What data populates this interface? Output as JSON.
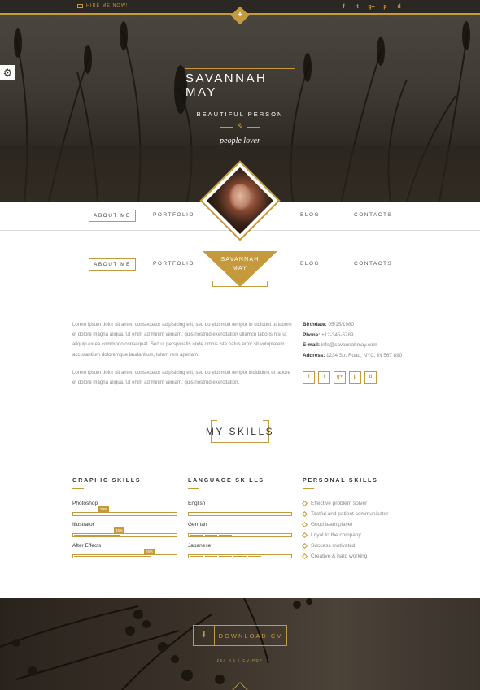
{
  "topbar": {
    "hire_label": "HIRE ME NOW!",
    "socials": [
      "f",
      "t",
      "g+",
      "p",
      "d"
    ],
    "accent": "#c49a3c",
    "background": "#2b2723"
  },
  "hero": {
    "name": "SAVANNAH MAY",
    "subtitle": "BEAUTIFUL PERSON",
    "ampersand": "&",
    "tagline": "people lover"
  },
  "nav": {
    "about": "ABOUT ME",
    "portfolio": "PORTFOLIO",
    "blog": "BLOG",
    "contacts": "CONTACTS",
    "brand_line1": "SAVANNAH",
    "brand_line2": "MAY"
  },
  "about": {
    "p1": "Lorem ipsum dolor sit amet, consectetur adipisicing elit, sed do eiusmod tempor in cididunt ut labore et dolore magna aliqua. Ut enim ad minim veniam, quis nostrud exercitation ullamco laboris nisi ut aliquip ex ea commodo consequat. Sed ut perspiciatis unde omnis iste natus error sit voluptatem accusantium doloremque laudantium, totam rem aperiam.",
    "p2": "Lorem ipsum dolor sit amet, consectetur adipisicing elit, sed do eiusmod tempor incididunt ut labore et dolore magna aliqua. Ut enim ad minim veniam, quis nostrud exercitation.",
    "birthdate_label": "Birthdate:",
    "birthdate": "05/15/1980",
    "phone_label": "Phone:",
    "phone": "+12-345-6789",
    "email_label": "E-mail:",
    "email": "info@savannahmay.com",
    "address_label": "Address:",
    "address": "1234 Str. Road, NYC, IN 567 890",
    "socials": [
      "f",
      "t",
      "g+",
      "p",
      "d"
    ]
  },
  "skills": {
    "heading": "MY SKILLS",
    "graphic_title": "GRAPHIC SKILLS",
    "language_title": "LANGUAGE SKILLS",
    "personal_title": "PERSONAL SKILLS",
    "graphic": [
      {
        "name": "Photoshop",
        "percent": 30,
        "label": "30%"
      },
      {
        "name": "Illustrator",
        "percent": 45,
        "label": "45%"
      },
      {
        "name": "After Effects",
        "percent": 75,
        "label": "75%"
      }
    ],
    "language": [
      {
        "name": "English",
        "level": 6,
        "total": 7
      },
      {
        "name": "German",
        "level": 3,
        "total": 7
      },
      {
        "name": "Japanese",
        "level": 5,
        "total": 7
      }
    ],
    "personal": [
      "Effective problem solver",
      "Tactful and patient communicator",
      "Good team player",
      "Loyal to the company",
      "Success motivated",
      "Creative & hard working"
    ]
  },
  "download": {
    "label": "DOWNLOAD CV",
    "size": "254 KB | CV.PDF"
  }
}
